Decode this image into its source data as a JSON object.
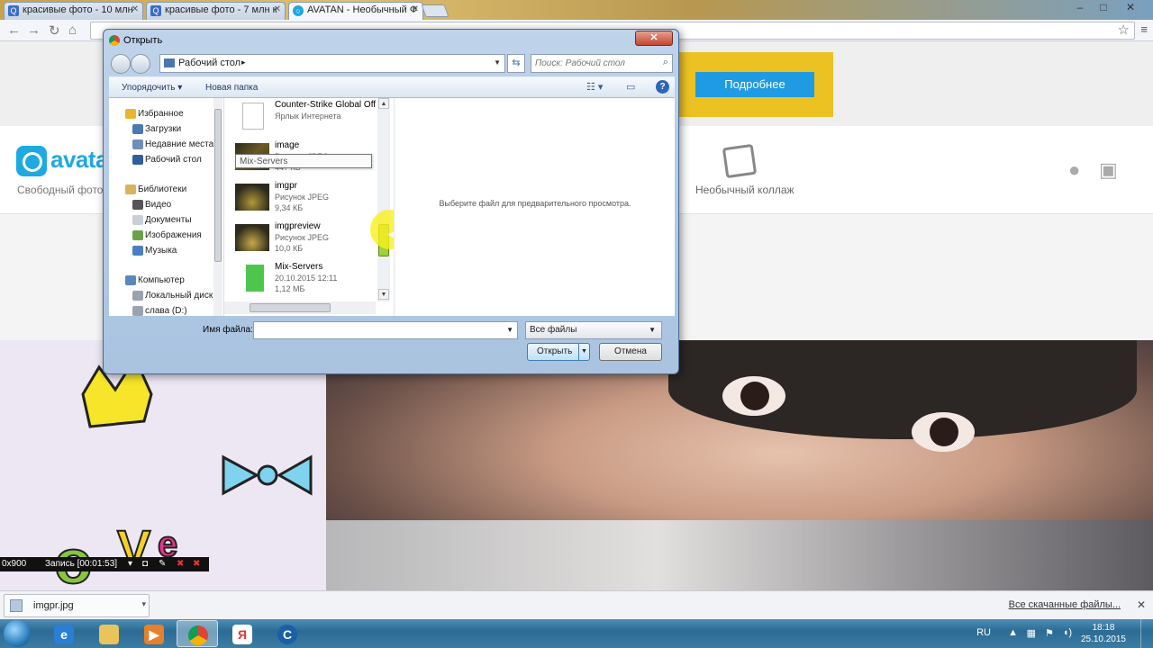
{
  "browser": {
    "tabs": [
      {
        "title": "красивые фото - 10 млн",
        "favicon": "search-icon"
      },
      {
        "title": "красивые фото - 7 млн к",
        "favicon": "search-icon"
      },
      {
        "title": "AVATAN - Необычный Ф",
        "favicon": "avatan-icon"
      }
    ],
    "window_controls": {
      "minimize": "–",
      "maximize": "□",
      "close": "✕"
    }
  },
  "page": {
    "banner_button": "Подробнее",
    "logo_text": "avatan",
    "slogan": "Свободный фоторедактор",
    "collage_label": "Необычный коллаж"
  },
  "dialog": {
    "title": "Открыть",
    "address": "Рабочий стол",
    "search_placeholder": "Поиск: Рабочий стол",
    "organize": "Упорядочить ▾",
    "new_folder": "Новая папка",
    "nav": {
      "favorites": "Избранное",
      "downloads": "Загрузки",
      "recent": "Недавние места",
      "desktop": "Рабочий стол",
      "libraries": "Библиотеки",
      "video": "Видео",
      "documents": "Документы",
      "images": "Изображения",
      "music": "Музыка",
      "computer": "Компьютер",
      "local_disk": "Локальный диск",
      "drive_d": "слава (D:)"
    },
    "files": [
      {
        "name": "Counter-Strike Global Offe",
        "type": "Ярлык Интернета",
        "size": ""
      },
      {
        "name": "image",
        "type": "Рисунок JPEG",
        "size": "447 КБ"
      },
      {
        "name": "imgpr",
        "type": "Рисунок JPEG",
        "size": "9,34 КБ"
      },
      {
        "name": "imgpreview",
        "type": "Рисунок JPEG",
        "size": "10,0 КБ"
      },
      {
        "name": "Mix-Servers",
        "type": "20.10.2015 12:11",
        "size": "1,12 МБ"
      }
    ],
    "tooltip": "Mix-Servers",
    "preview_message": "Выберите файл для предварительного просмотра.",
    "filename_label": "Имя файла:",
    "filename_value": "",
    "filetype": "Все файлы",
    "open_button": "Открыть",
    "cancel_button": "Отмена"
  },
  "recorder": {
    "resolution": "0x900",
    "status": "Запись [00:01:53]"
  },
  "downloads": {
    "file": "imgpr.jpg",
    "all_link": "Все скачанные файлы..."
  },
  "taskbar": {
    "lang": "RU",
    "time": "18:18",
    "date": "25.10.2015",
    "apps": [
      "ie-icon",
      "explorer-icon",
      "media-player-icon",
      "chrome-icon",
      "yandex-icon",
      "cc-icon"
    ]
  },
  "colors": {
    "accent_blue": "#1e9be3",
    "banner_yellow": "#ecc223",
    "logo": "#1fa9e1",
    "scroll_thumb_green": "#9fd23a"
  }
}
